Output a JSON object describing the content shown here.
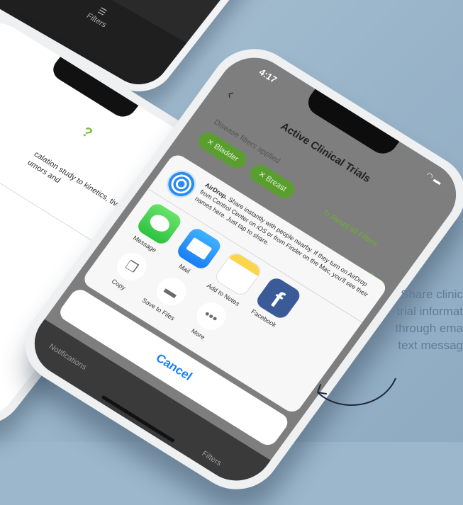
{
  "background": {
    "color": "#9cb7cc"
  },
  "top_phone": {
    "tab_label": "Filters"
  },
  "left_phone": {
    "description": "calation study to kinetics, tivity of umors and"
  },
  "main_phone": {
    "time": "4:17",
    "title": "Active Clinical Trials",
    "filters_label": "Disease filters applied",
    "chips": [
      "Bladder",
      "Breast"
    ],
    "reset_label": "Reset all Filters",
    "share_sheet": {
      "airdrop_title": "AirDrop.",
      "airdrop_text": "Share instantly with people nearby. If they turn on AirDrop from Control Center on iOS or from Finder on the Mac, you'll see their names here. Just tap to share.",
      "apps": [
        "Message",
        "Mail",
        "Add to Notes",
        "Facebook"
      ],
      "actions": [
        "Copy",
        "Save to Files",
        "More"
      ],
      "cancel_label": "Cancel"
    },
    "tabbar": {
      "notifications_label": "Notifications",
      "filters_label": "Filters"
    },
    "accent_green": "#6cae36",
    "accent_blue": "#1a7ef5"
  },
  "caption": {
    "lines": [
      "Share clinic",
      "trial informat",
      "through ema",
      "text messag"
    ]
  }
}
